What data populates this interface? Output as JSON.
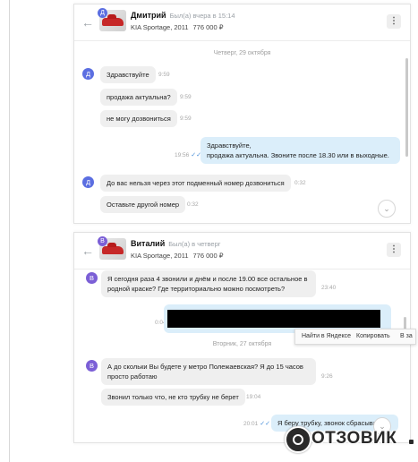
{
  "chat1": {
    "avatar_letter": "Д",
    "name": "Дмитрий",
    "seen": "Был(а) вчера в 15:14",
    "car": "KIA Sportage, 2011",
    "price": "776 000 ₽",
    "date_sep": "Четверг, 29 октября",
    "messages": [
      {
        "text": "Здравствуйте",
        "time": "9:59"
      },
      {
        "text": "продажа актуальна?",
        "time": "9:59"
      },
      {
        "text": "не могу дозвониться",
        "time": "9:59"
      },
      {
        "line1": "Здравствуйте,",
        "line2": "продажа актуальна. Звоните после 18.30 или в выходные.",
        "time": "19:56"
      },
      {
        "text": "До вас нельзя через этот подменный номер дозвониться",
        "time": "0:32"
      },
      {
        "text": "Оставьте другой номер",
        "time": "0:32"
      }
    ]
  },
  "chat2": {
    "avatar_letter": "В",
    "name": "Виталий",
    "seen": "Был(а) в четверг",
    "car": "KIA Sportage, 2011",
    "price": "776 000 ₽",
    "date_sep": "Вторник, 27 октября",
    "messages": [
      {
        "line1": "Я сегодня раза 4 звонили и днём и после 19.00 все остальное в",
        "line2": "родной краске? Где территориально можно посмотреть?",
        "time": "23:40"
      },
      {
        "time": "0:04"
      },
      {
        "line1": "А до скольки Вы будете у метро Полежаевская? Я до 15 часов",
        "line2": "просто работаю",
        "time": "9:26"
      },
      {
        "text": "Звонил только что, не кто трубку не берет",
        "time": "19:04"
      },
      {
        "text": "Я беру трубку, звонок сбрасыва",
        "time": "20:01"
      }
    ]
  },
  "context_menu": {
    "find": "Найти в Яндексе",
    "copy": "Копировать",
    "more": "В за"
  },
  "icons": {
    "back": "back-arrow-icon",
    "more": "kebab-menu-icon",
    "read": "double-check-icon",
    "scroll": "chevron-down-icon"
  },
  "watermark": "ОТЗОВИК",
  "colors": {
    "outgoing_bubble": "#dbeefa",
    "incoming_bubble": "#efefef",
    "avatar_d": "#5b6ee1",
    "avatar_v": "#7b5fd6"
  }
}
